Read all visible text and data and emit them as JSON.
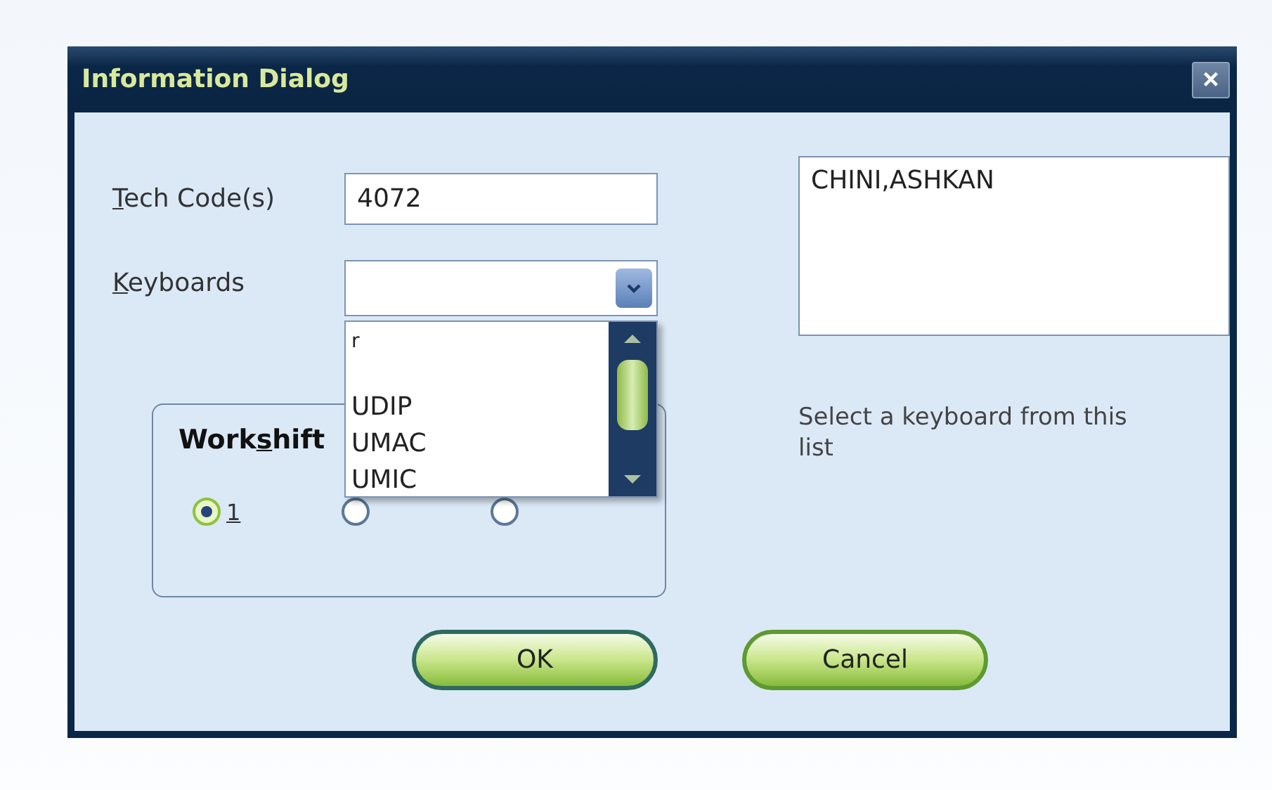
{
  "window": {
    "title": "Information Dialog",
    "close": "×"
  },
  "tech_codes": {
    "label_parts": [
      {
        "text": "T",
        "underlined": true
      },
      {
        "text": "ech Code(s)",
        "underlined": false
      }
    ],
    "value": "4072"
  },
  "keyboards": {
    "label_parts": [
      {
        "text": "K",
        "underlined": true
      },
      {
        "text": "eyboards",
        "underlined": false
      }
    ],
    "expanded": true,
    "options": [
      {
        "kind": "partial",
        "label": "r"
      },
      {
        "kind": "blank"
      },
      {
        "kind": "item",
        "label": "UDIP"
      },
      {
        "kind": "item",
        "label": "UMAC"
      },
      {
        "kind": "item",
        "label": "UMIC"
      }
    ]
  },
  "workshift": {
    "title_parts": [
      {
        "text": "Work",
        "underlined": false
      },
      {
        "text": "s",
        "underlined": true
      },
      {
        "text": "hift",
        "underlined": false
      }
    ],
    "options": [
      {
        "label": "1",
        "selected": true
      },
      {
        "selected": false
      },
      {
        "selected": false
      }
    ]
  },
  "name_box": {
    "value": "CHINI,ASHKAN"
  },
  "hint": "Select a keyboard from this list",
  "buttons": [
    {
      "label": "OK",
      "kind": "default"
    },
    {
      "label": "Cancel",
      "kind": "normal"
    }
  ]
}
